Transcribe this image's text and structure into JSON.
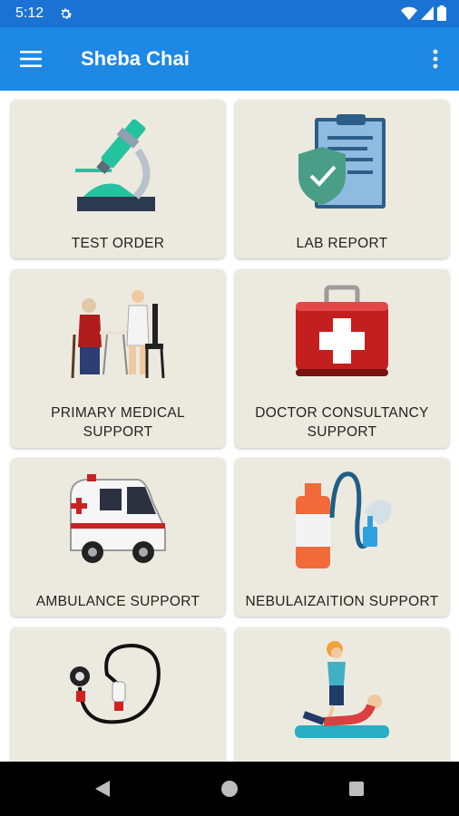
{
  "status_bar": {
    "time": "5:12"
  },
  "app_bar": {
    "title": "Sheba Chai"
  },
  "services": [
    {
      "label_line1": "TEST ORDER",
      "label_line2": ""
    },
    {
      "label_line1": "LAB REPORT",
      "label_line2": ""
    },
    {
      "label_line1": "PRIMARY MEDICAL",
      "label_line2": "SUPPORT"
    },
    {
      "label_line1": "DOCTOR CONSULTANCY",
      "label_line2": "SUPPORT"
    },
    {
      "label_line1": "AMBULANCE SUPPORT",
      "label_line2": ""
    },
    {
      "label_line1": "NEBULAIZAITION SUPPORT",
      "label_line2": ""
    },
    {
      "label_line1": "",
      "label_line2": ""
    },
    {
      "label_line1": "",
      "label_line2": ""
    }
  ],
  "colors": {
    "status_bar": "#1a73d4",
    "app_bar": "#1e88e5",
    "card": "#eceadf"
  }
}
